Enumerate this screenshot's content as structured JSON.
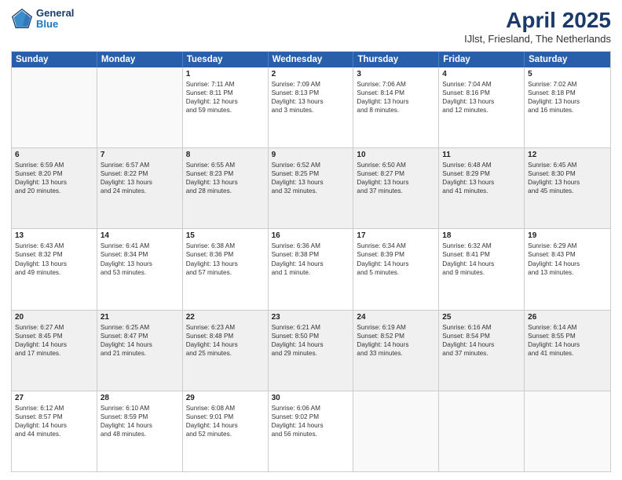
{
  "header": {
    "logo_line1": "General",
    "logo_line2": "Blue",
    "title": "April 2025",
    "subtitle": "IJlst, Friesland, The Netherlands"
  },
  "weekdays": [
    "Sunday",
    "Monday",
    "Tuesday",
    "Wednesday",
    "Thursday",
    "Friday",
    "Saturday"
  ],
  "rows": [
    [
      {
        "day": "",
        "lines": [],
        "empty": true
      },
      {
        "day": "",
        "lines": [],
        "empty": true
      },
      {
        "day": "1",
        "lines": [
          "Sunrise: 7:11 AM",
          "Sunset: 8:11 PM",
          "Daylight: 12 hours",
          "and 59 minutes."
        ]
      },
      {
        "day": "2",
        "lines": [
          "Sunrise: 7:09 AM",
          "Sunset: 8:13 PM",
          "Daylight: 13 hours",
          "and 3 minutes."
        ]
      },
      {
        "day": "3",
        "lines": [
          "Sunrise: 7:06 AM",
          "Sunset: 8:14 PM",
          "Daylight: 13 hours",
          "and 8 minutes."
        ]
      },
      {
        "day": "4",
        "lines": [
          "Sunrise: 7:04 AM",
          "Sunset: 8:16 PM",
          "Daylight: 13 hours",
          "and 12 minutes."
        ]
      },
      {
        "day": "5",
        "lines": [
          "Sunrise: 7:02 AM",
          "Sunset: 8:18 PM",
          "Daylight: 13 hours",
          "and 16 minutes."
        ]
      }
    ],
    [
      {
        "day": "6",
        "lines": [
          "Sunrise: 6:59 AM",
          "Sunset: 8:20 PM",
          "Daylight: 13 hours",
          "and 20 minutes."
        ],
        "shaded": true
      },
      {
        "day": "7",
        "lines": [
          "Sunrise: 6:57 AM",
          "Sunset: 8:22 PM",
          "Daylight: 13 hours",
          "and 24 minutes."
        ],
        "shaded": true
      },
      {
        "day": "8",
        "lines": [
          "Sunrise: 6:55 AM",
          "Sunset: 8:23 PM",
          "Daylight: 13 hours",
          "and 28 minutes."
        ],
        "shaded": true
      },
      {
        "day": "9",
        "lines": [
          "Sunrise: 6:52 AM",
          "Sunset: 8:25 PM",
          "Daylight: 13 hours",
          "and 32 minutes."
        ],
        "shaded": true
      },
      {
        "day": "10",
        "lines": [
          "Sunrise: 6:50 AM",
          "Sunset: 8:27 PM",
          "Daylight: 13 hours",
          "and 37 minutes."
        ],
        "shaded": true
      },
      {
        "day": "11",
        "lines": [
          "Sunrise: 6:48 AM",
          "Sunset: 8:29 PM",
          "Daylight: 13 hours",
          "and 41 minutes."
        ],
        "shaded": true
      },
      {
        "day": "12",
        "lines": [
          "Sunrise: 6:45 AM",
          "Sunset: 8:30 PM",
          "Daylight: 13 hours",
          "and 45 minutes."
        ],
        "shaded": true
      }
    ],
    [
      {
        "day": "13",
        "lines": [
          "Sunrise: 6:43 AM",
          "Sunset: 8:32 PM",
          "Daylight: 13 hours",
          "and 49 minutes."
        ]
      },
      {
        "day": "14",
        "lines": [
          "Sunrise: 6:41 AM",
          "Sunset: 8:34 PM",
          "Daylight: 13 hours",
          "and 53 minutes."
        ]
      },
      {
        "day": "15",
        "lines": [
          "Sunrise: 6:38 AM",
          "Sunset: 8:36 PM",
          "Daylight: 13 hours",
          "and 57 minutes."
        ]
      },
      {
        "day": "16",
        "lines": [
          "Sunrise: 6:36 AM",
          "Sunset: 8:38 PM",
          "Daylight: 14 hours",
          "and 1 minute."
        ]
      },
      {
        "day": "17",
        "lines": [
          "Sunrise: 6:34 AM",
          "Sunset: 8:39 PM",
          "Daylight: 14 hours",
          "and 5 minutes."
        ]
      },
      {
        "day": "18",
        "lines": [
          "Sunrise: 6:32 AM",
          "Sunset: 8:41 PM",
          "Daylight: 14 hours",
          "and 9 minutes."
        ]
      },
      {
        "day": "19",
        "lines": [
          "Sunrise: 6:29 AM",
          "Sunset: 8:43 PM",
          "Daylight: 14 hours",
          "and 13 minutes."
        ]
      }
    ],
    [
      {
        "day": "20",
        "lines": [
          "Sunrise: 6:27 AM",
          "Sunset: 8:45 PM",
          "Daylight: 14 hours",
          "and 17 minutes."
        ],
        "shaded": true
      },
      {
        "day": "21",
        "lines": [
          "Sunrise: 6:25 AM",
          "Sunset: 8:47 PM",
          "Daylight: 14 hours",
          "and 21 minutes."
        ],
        "shaded": true
      },
      {
        "day": "22",
        "lines": [
          "Sunrise: 6:23 AM",
          "Sunset: 8:48 PM",
          "Daylight: 14 hours",
          "and 25 minutes."
        ],
        "shaded": true
      },
      {
        "day": "23",
        "lines": [
          "Sunrise: 6:21 AM",
          "Sunset: 8:50 PM",
          "Daylight: 14 hours",
          "and 29 minutes."
        ],
        "shaded": true
      },
      {
        "day": "24",
        "lines": [
          "Sunrise: 6:19 AM",
          "Sunset: 8:52 PM",
          "Daylight: 14 hours",
          "and 33 minutes."
        ],
        "shaded": true
      },
      {
        "day": "25",
        "lines": [
          "Sunrise: 6:16 AM",
          "Sunset: 8:54 PM",
          "Daylight: 14 hours",
          "and 37 minutes."
        ],
        "shaded": true
      },
      {
        "day": "26",
        "lines": [
          "Sunrise: 6:14 AM",
          "Sunset: 8:55 PM",
          "Daylight: 14 hours",
          "and 41 minutes."
        ],
        "shaded": true
      }
    ],
    [
      {
        "day": "27",
        "lines": [
          "Sunrise: 6:12 AM",
          "Sunset: 8:57 PM",
          "Daylight: 14 hours",
          "and 44 minutes."
        ]
      },
      {
        "day": "28",
        "lines": [
          "Sunrise: 6:10 AM",
          "Sunset: 8:59 PM",
          "Daylight: 14 hours",
          "and 48 minutes."
        ]
      },
      {
        "day": "29",
        "lines": [
          "Sunrise: 6:08 AM",
          "Sunset: 9:01 PM",
          "Daylight: 14 hours",
          "and 52 minutes."
        ]
      },
      {
        "day": "30",
        "lines": [
          "Sunrise: 6:06 AM",
          "Sunset: 9:02 PM",
          "Daylight: 14 hours",
          "and 56 minutes."
        ]
      },
      {
        "day": "",
        "lines": [],
        "empty": true
      },
      {
        "day": "",
        "lines": [],
        "empty": true
      },
      {
        "day": "",
        "lines": [],
        "empty": true
      }
    ]
  ]
}
